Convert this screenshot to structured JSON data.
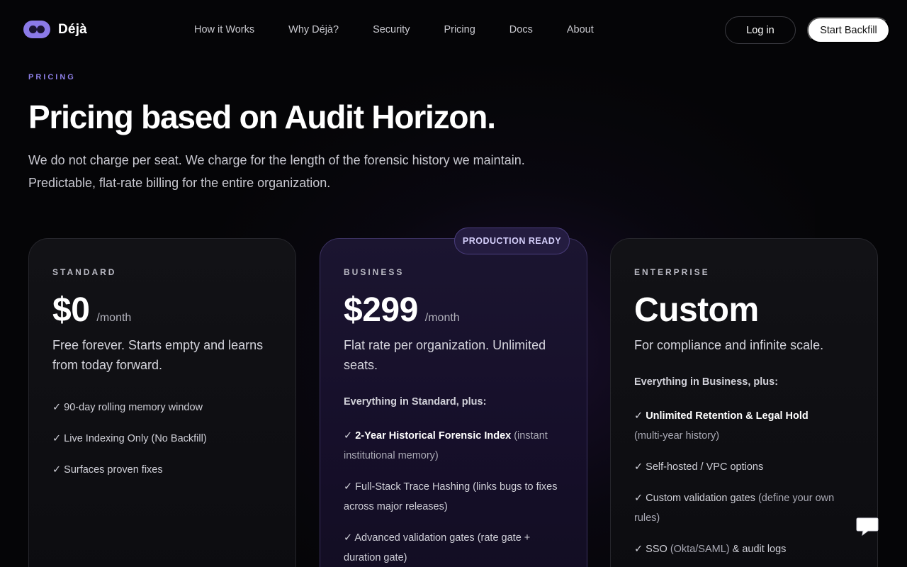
{
  "brand": {
    "name": "Déjà",
    "accent": "#8b7ae8"
  },
  "nav": {
    "links": [
      "How it Works",
      "Why Déjà?",
      "Security",
      "Pricing",
      "Docs",
      "About"
    ],
    "login": "Log in",
    "start": "Start Backfill"
  },
  "hero": {
    "eyebrow": "PRICING",
    "headline": "Pricing based on Audit Horizon.",
    "sub_line1": "We do not charge per seat. We charge for the length of the forensic history we maintain.",
    "sub_line2": "Predictable, flat-rate billing for the entire organization."
  },
  "plans": {
    "standard": {
      "tier": "STANDARD",
      "price": "$0",
      "per": "/month",
      "desc": "Free forever. Starts empty and learns from today forward.",
      "features": [
        "✓ 90-day rolling memory window",
        "✓ Live Indexing Only (No Backfill)",
        "✓ Surfaces proven fixes"
      ]
    },
    "business": {
      "badge": "PRODUCTION READY",
      "tier": "BUSINESS",
      "price": "$299",
      "per": "/month",
      "desc": "Flat rate per organization. Unlimited seats.",
      "plus": "Everything in Standard, plus:",
      "f1_check": "✓ ",
      "f1_bold": "2-Year Historical Forensic Index",
      "f1_rest": " (instant institutional memory)",
      "f2": "✓ Full-Stack Trace Hashing (links bugs to fixes across major releases)",
      "f3": "✓ Advanced validation gates (rate gate + duration gate)"
    },
    "enterprise": {
      "tier": "ENTERPRISE",
      "price": "Custom",
      "desc": "For compliance and infinite scale.",
      "plus": "Everything in Business, plus:",
      "f1_check": "✓ ",
      "f1_bold": "Unlimited Retention & Legal Hold",
      "f1_rest": "(multi-year history)",
      "f2": "✓ Self-hosted / VPC options",
      "f3_main": "✓ Custom validation gates",
      "f3_muted": " (define your own rules)",
      "f4_a": "✓ SSO ",
      "f4_muted": "(Okta/SAML)",
      "f4_b": " & audit logs"
    }
  },
  "chat": {
    "icon": "chat-bubble-icon"
  }
}
